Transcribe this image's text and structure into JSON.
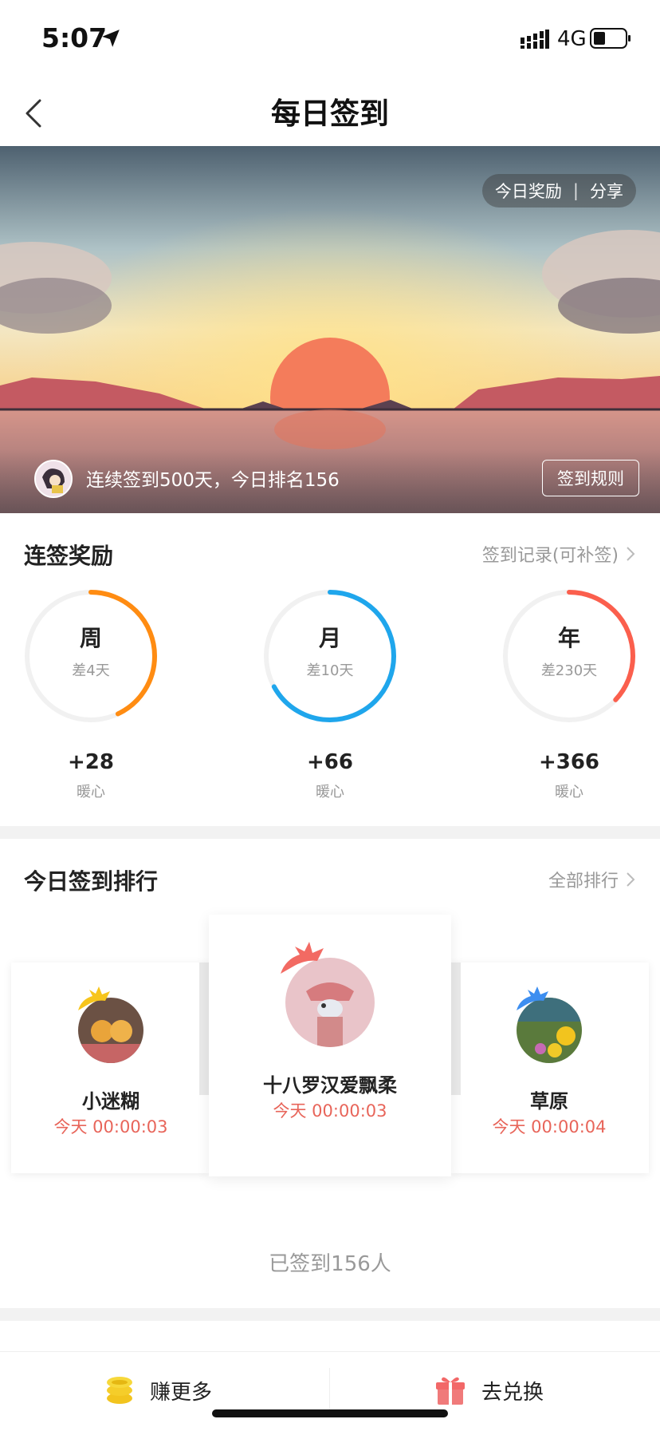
{
  "status_bar": {
    "time": "5:07",
    "network": "4G"
  },
  "nav": {
    "title": "每日签到"
  },
  "banner": {
    "pill": {
      "reward": "今日奖励",
      "separator": "|",
      "share": "分享"
    },
    "streak_text": "连续签到500天，今日排名156",
    "rules_button": "签到规则"
  },
  "streak_rewards": {
    "title": "连签奖励",
    "record_link": "签到记录(可补签)",
    "rings": [
      {
        "period": "周",
        "remaining": "差4天",
        "reward": "+28",
        "unit": "暖心",
        "progress": 0.43,
        "color": "#ff8c12"
      },
      {
        "period": "月",
        "remaining": "差10天",
        "reward": "+66",
        "unit": "暖心",
        "progress": 0.67,
        "color": "#1fa6ec"
      },
      {
        "period": "年",
        "remaining": "差230天",
        "reward": "+366",
        "unit": "暖心",
        "progress": 0.37,
        "color": "#fb5f4d"
      }
    ]
  },
  "ranking": {
    "title": "今日签到排行",
    "all_link": "全部排行",
    "top": [
      {
        "name": "十八罗汉爱飘柔",
        "time": "今天  00:00:03",
        "crown_color": "#f26a63"
      },
      {
        "name": "小迷糊",
        "time": "今天  00:00:03",
        "crown_color": "#f7c51c"
      },
      {
        "name": "草原",
        "time": "今天  00:00:04",
        "crown_color": "#3d8ef0"
      }
    ],
    "signed_count": "已签到156人"
  },
  "bottom_bar": {
    "earn_label": "赚更多",
    "exchange_label": "去兑换"
  }
}
